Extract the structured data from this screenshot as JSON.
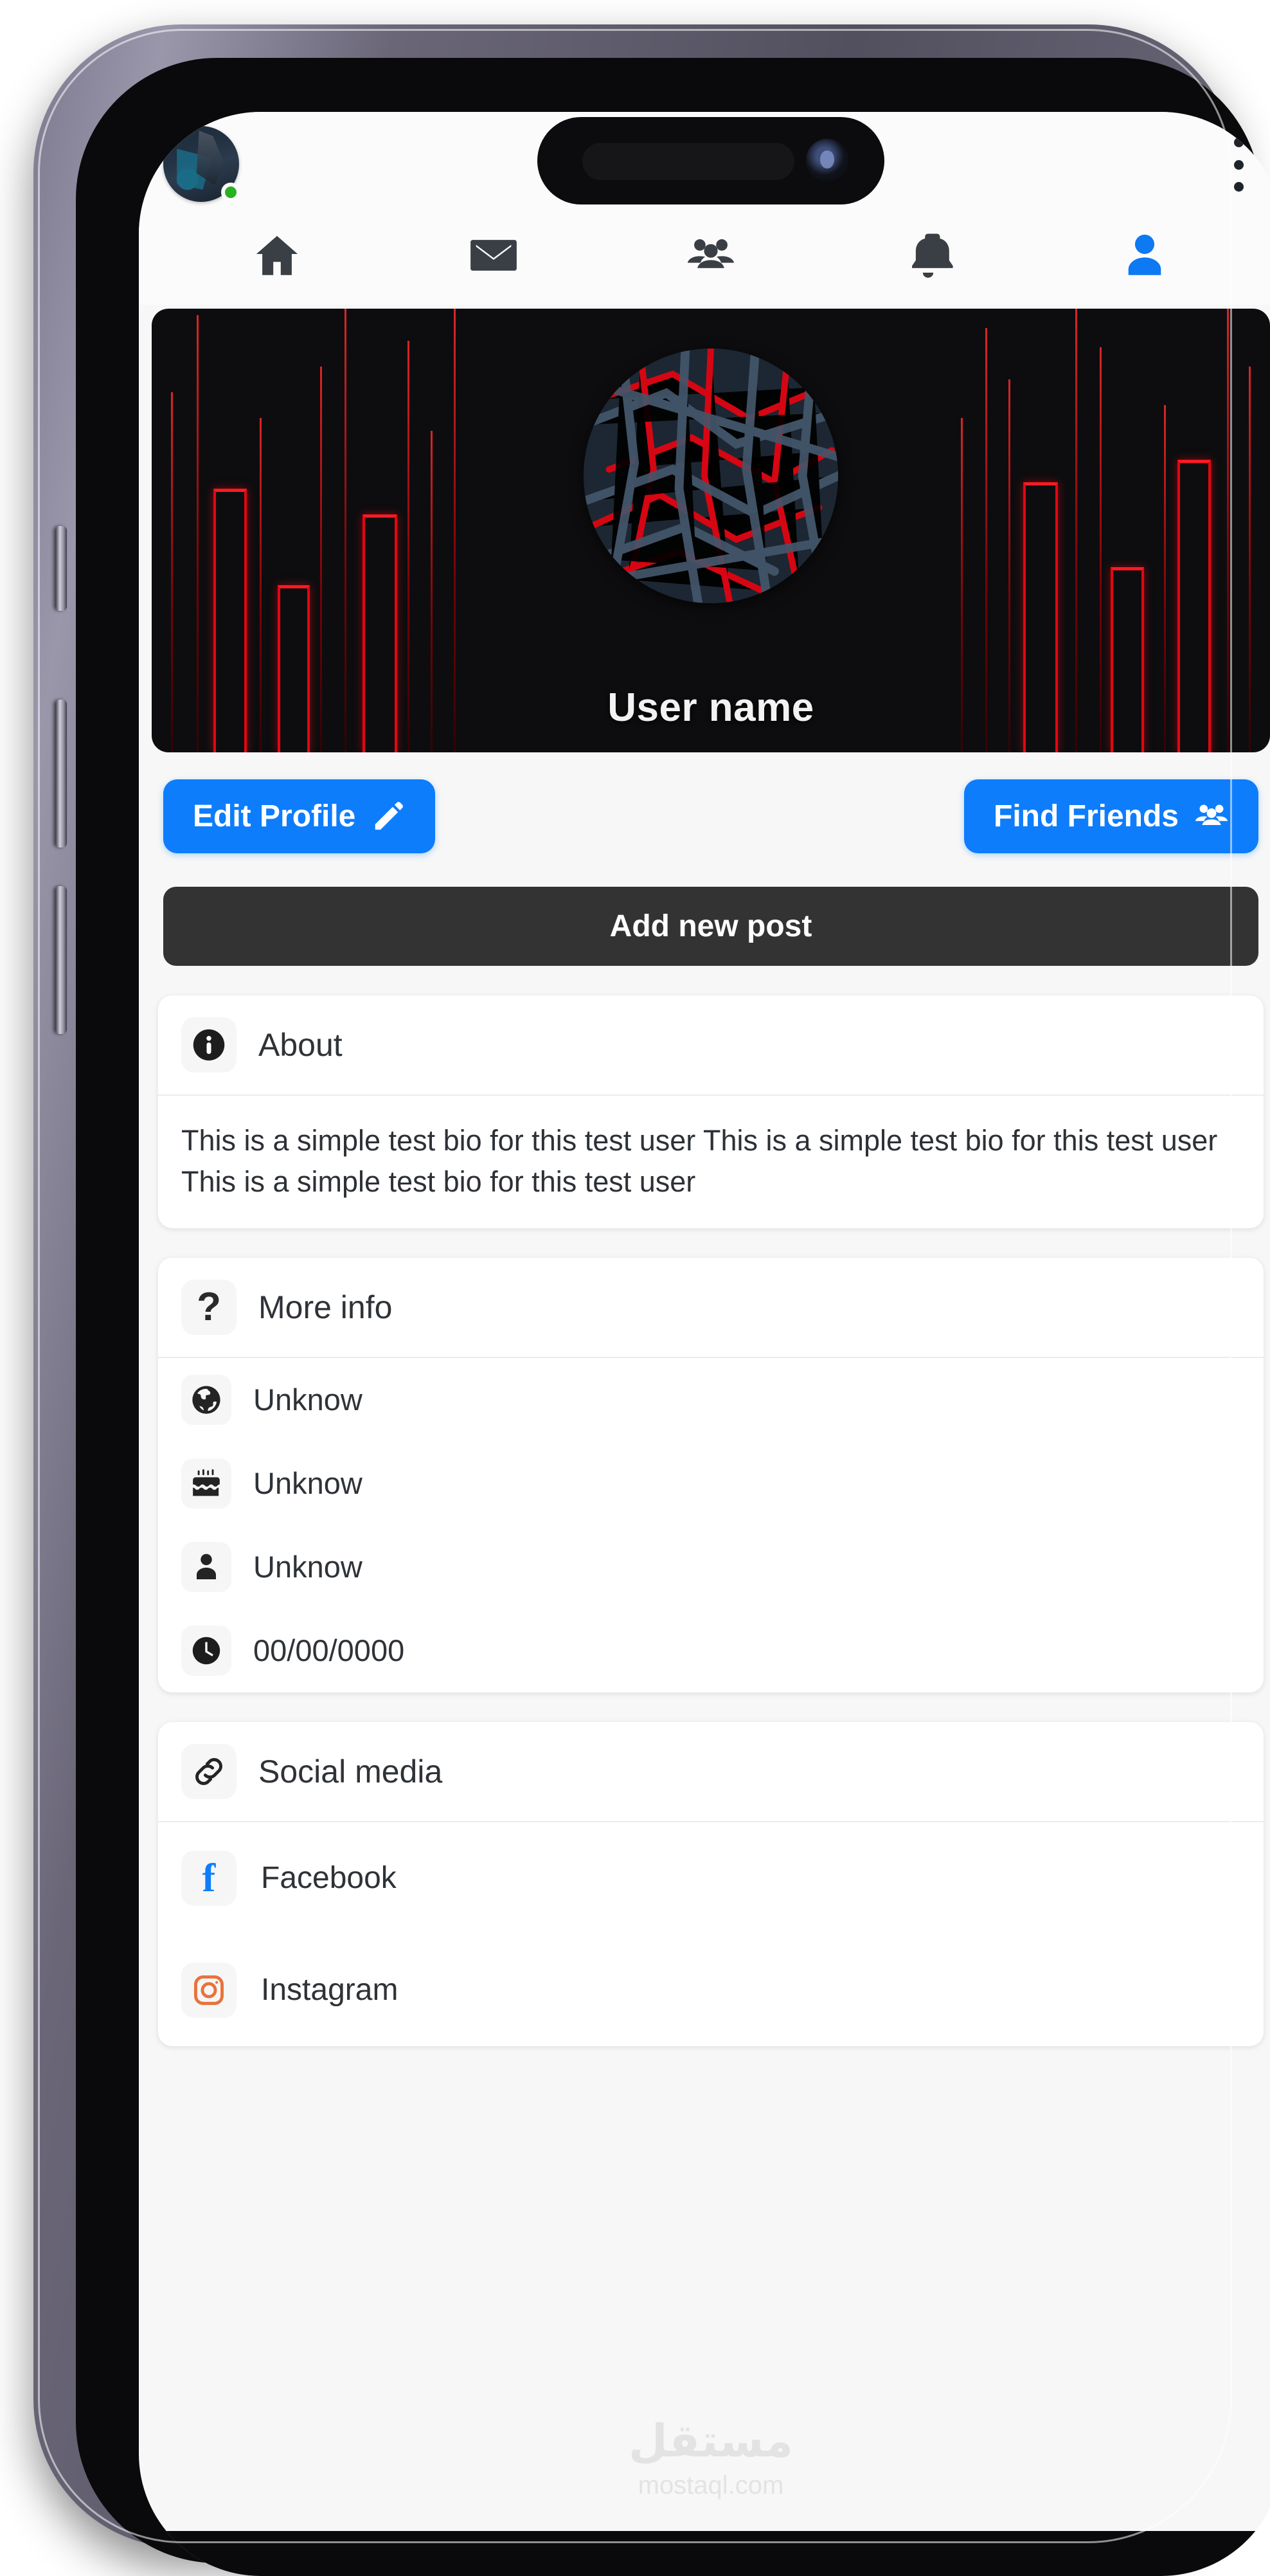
{
  "header": {
    "avatar_status": "online",
    "menu_icon": "three-dots-vertical-icon",
    "nav_items": [
      {
        "name": "home",
        "icon": "home-icon",
        "active": false
      },
      {
        "name": "messages",
        "icon": "envelope-icon",
        "active": false
      },
      {
        "name": "friends",
        "icon": "people-icon",
        "active": false
      },
      {
        "name": "alerts",
        "icon": "bell-icon",
        "active": false
      },
      {
        "name": "profile",
        "icon": "person-icon",
        "active": true
      }
    ]
  },
  "banner": {
    "username": "User name",
    "background_color": "#0d0d0f",
    "bar_color": "#e40512"
  },
  "actions": {
    "edit_profile_label": "Edit Profile",
    "edit_profile_icon": "pencil-icon",
    "find_friends_label": "Find Friends",
    "find_friends_icon": "people-group-icon",
    "add_post_label": "Add new post",
    "primary_color": "#0d7dfc",
    "dark_color": "#333333"
  },
  "about_card": {
    "title": "About",
    "icon": "info-circle-icon",
    "bio": "This is a simple test bio for this test user This is a simple test bio for this test user This is a simple test bio for this test user"
  },
  "more_info_card": {
    "title": "More info",
    "icon": "question-mark-icon",
    "rows": [
      {
        "icon": "globe-icon",
        "value": "Unknow"
      },
      {
        "icon": "cake-icon",
        "value": "Unknow"
      },
      {
        "icon": "person-icon",
        "value": "Unknow"
      },
      {
        "icon": "clock-icon",
        "value": "00/00/0000"
      }
    ]
  },
  "social_card": {
    "title": "Social media",
    "icon": "link-icon",
    "rows": [
      {
        "icon": "facebook-icon",
        "label": "Facebook",
        "color": "#0d7dfc"
      },
      {
        "icon": "instagram-icon",
        "label": "Instagram",
        "color": "#e8733a"
      }
    ]
  },
  "watermark": {
    "arabic": "مستقل",
    "latin": "mostaql.com"
  }
}
